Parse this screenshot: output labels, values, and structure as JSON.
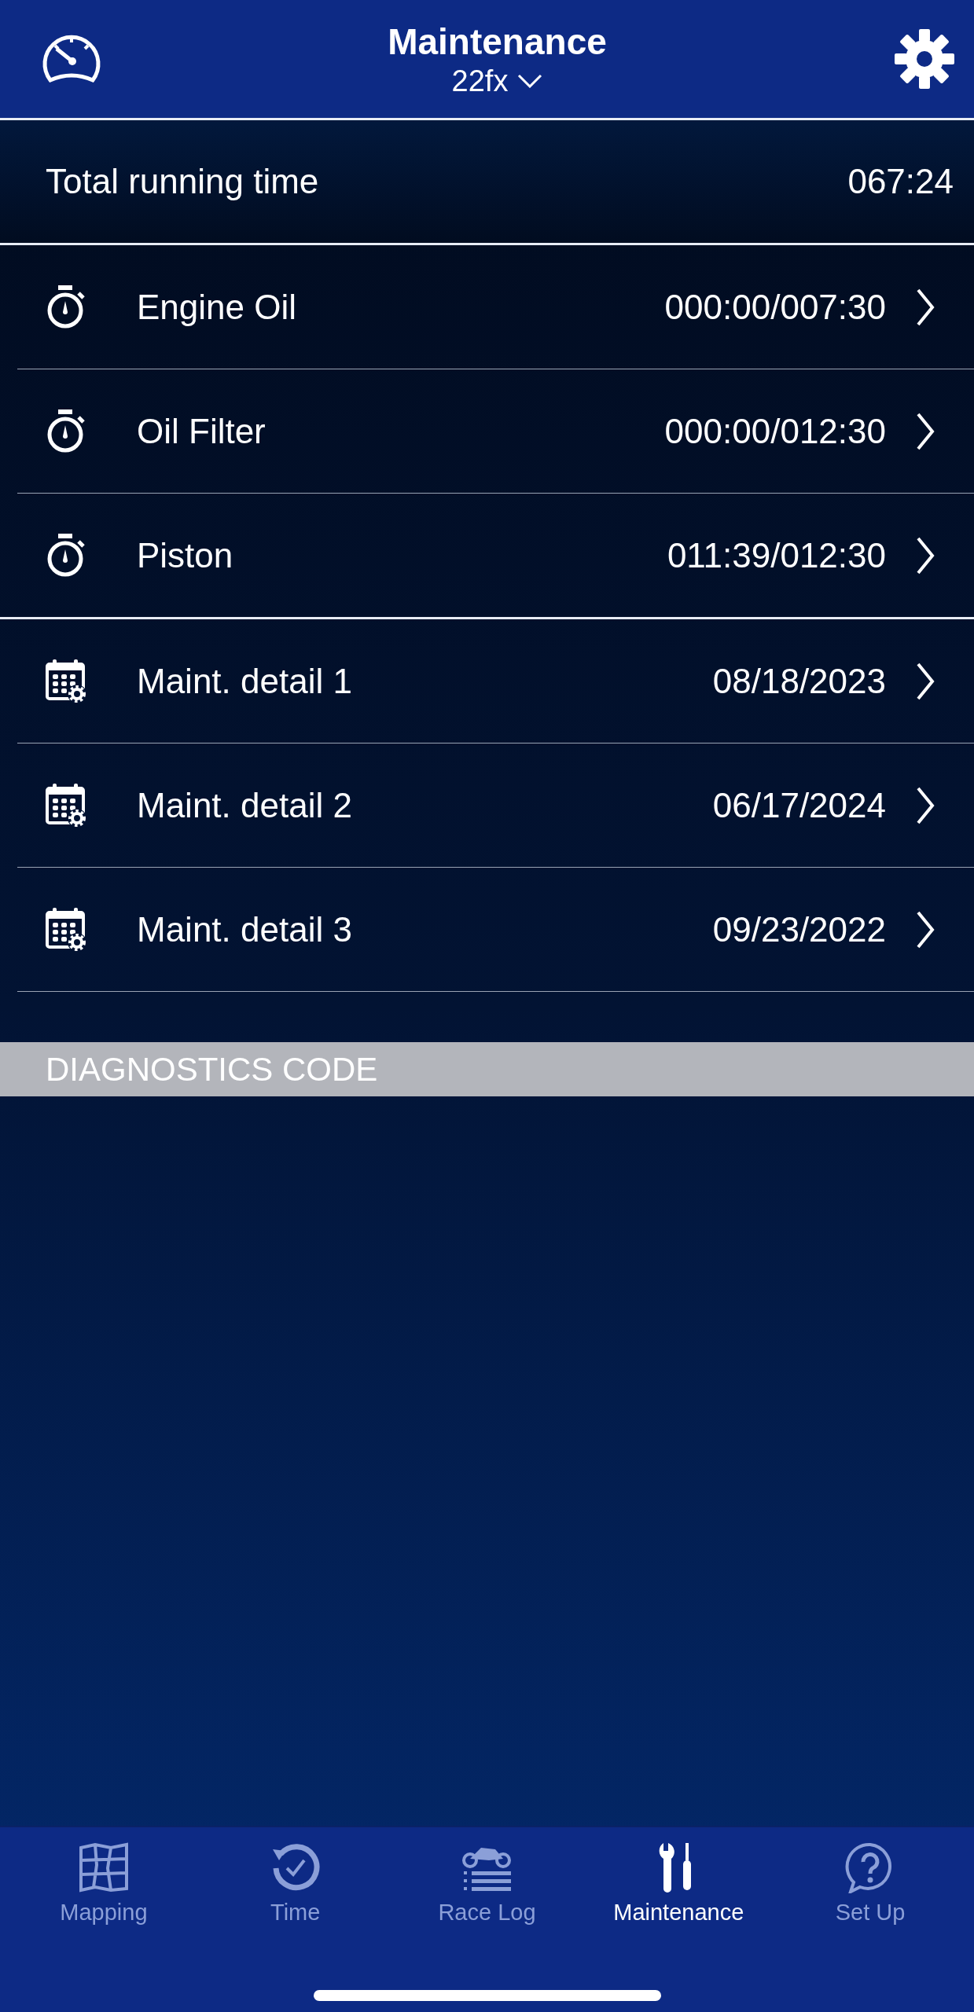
{
  "header": {
    "title": "Maintenance",
    "model": "22fx"
  },
  "total": {
    "label": "Total running time",
    "value": "067:24"
  },
  "items": [
    {
      "kind": "timer",
      "label": "Engine Oil",
      "value": "000:00/007:30"
    },
    {
      "kind": "timer",
      "label": "Oil Filter",
      "value": "000:00/012:30"
    },
    {
      "kind": "timer",
      "label": "Piston",
      "value": "011:39/012:30"
    },
    {
      "kind": "service",
      "label": "Maint. detail 1",
      "value": "08/18/2023"
    },
    {
      "kind": "service",
      "label": "Maint. detail 2",
      "value": "06/17/2024"
    },
    {
      "kind": "service",
      "label": "Maint. detail 3",
      "value": "09/23/2022"
    }
  ],
  "diagnostics": {
    "title": "DIAGNOSTICS CODE"
  },
  "tabs": [
    {
      "label": "Mapping",
      "selected": false
    },
    {
      "label": "Time",
      "selected": false
    },
    {
      "label": "Race Log",
      "selected": false
    },
    {
      "label": "Maintenance",
      "selected": true
    },
    {
      "label": "Set Up",
      "selected": false
    }
  ]
}
